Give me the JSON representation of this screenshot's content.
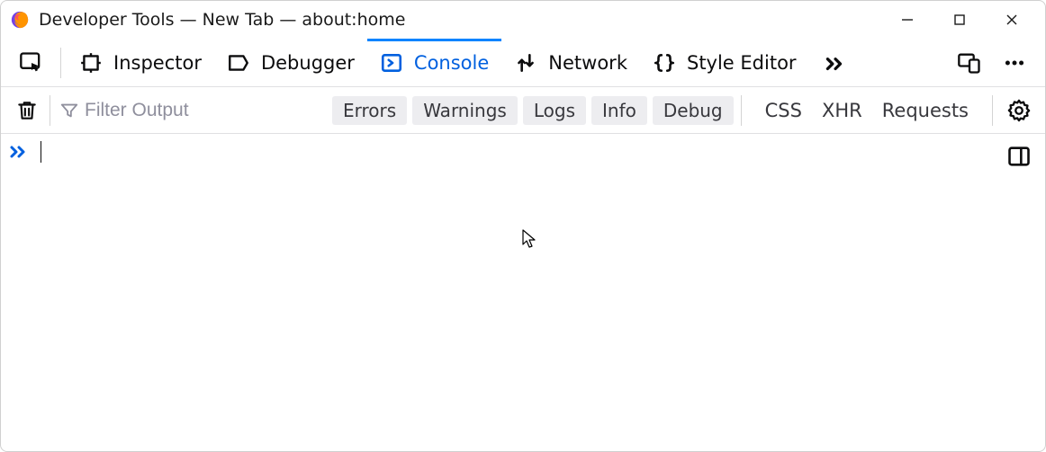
{
  "window": {
    "title": "Developer Tools — New Tab — about:home"
  },
  "tabs": {
    "inspector": "Inspector",
    "debugger": "Debugger",
    "console": "Console",
    "network": "Network",
    "style_editor": "Style Editor",
    "active": "console"
  },
  "filterbar": {
    "placeholder": "Filter Output",
    "chips": {
      "errors": "Errors",
      "warnings": "Warnings",
      "logs": "Logs",
      "info": "Info",
      "debug": "Debug"
    },
    "buttons": {
      "css": "CSS",
      "xhr": "XHR",
      "requests": "Requests"
    }
  }
}
